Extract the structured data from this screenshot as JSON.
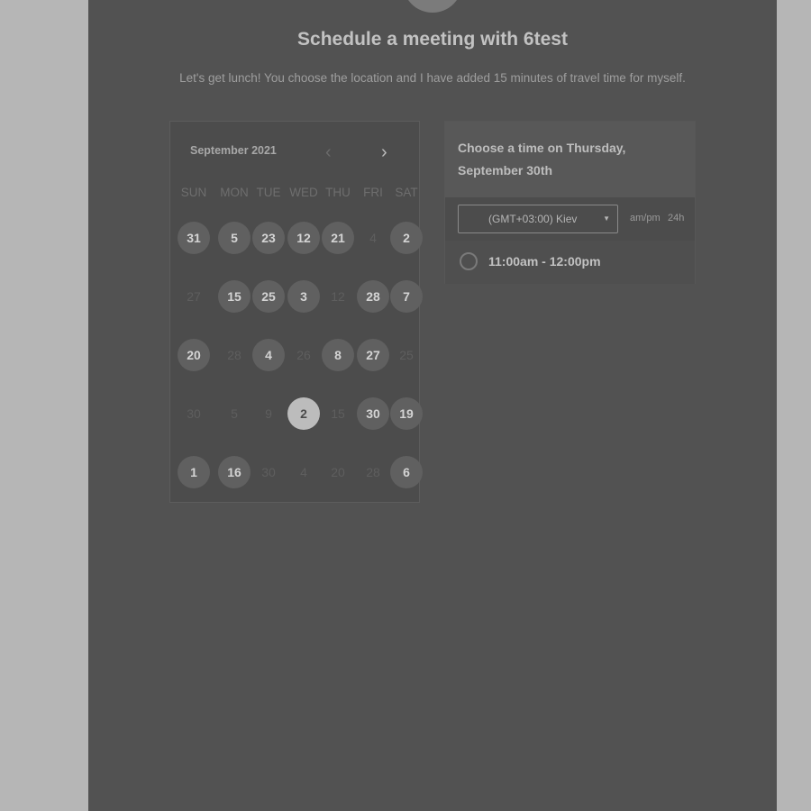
{
  "header": {
    "title": "Schedule a meeting with 6test",
    "description": "Let's get lunch! You choose the location and I have added 15 minutes of travel time for myself."
  },
  "calendar": {
    "month_label": "September 2021",
    "prev_icon": "‹",
    "next_icon": "›",
    "weekdays": [
      "SUN",
      "MON",
      "TUE",
      "WED",
      "THU",
      "FRI",
      "SAT"
    ],
    "weeks": [
      [
        {
          "d": "31",
          "s": "avail"
        },
        {
          "d": "5",
          "s": "avail"
        },
        {
          "d": "23",
          "s": "avail"
        },
        {
          "d": "12",
          "s": "avail"
        },
        {
          "d": "21",
          "s": "avail"
        },
        {
          "d": "4",
          "s": "dim"
        },
        {
          "d": "2",
          "s": "avail"
        }
      ],
      [
        {
          "d": "27",
          "s": "dim"
        },
        {
          "d": "15",
          "s": "avail"
        },
        {
          "d": "25",
          "s": "avail"
        },
        {
          "d": "3",
          "s": "avail"
        },
        {
          "d": "12",
          "s": "dim"
        },
        {
          "d": "28",
          "s": "avail"
        },
        {
          "d": "7",
          "s": "avail"
        }
      ],
      [
        {
          "d": "20",
          "s": "avail"
        },
        {
          "d": "28",
          "s": "dim"
        },
        {
          "d": "4",
          "s": "avail"
        },
        {
          "d": "26",
          "s": "dim"
        },
        {
          "d": "8",
          "s": "avail"
        },
        {
          "d": "27",
          "s": "avail"
        },
        {
          "d": "25",
          "s": "dim"
        }
      ],
      [
        {
          "d": "30",
          "s": "dim"
        },
        {
          "d": "5",
          "s": "dim"
        },
        {
          "d": "9",
          "s": "dim"
        },
        {
          "d": "2",
          "s": "sel"
        },
        {
          "d": "15",
          "s": "dim"
        },
        {
          "d": "30",
          "s": "avail"
        },
        {
          "d": "19",
          "s": "avail"
        }
      ],
      [
        {
          "d": "1",
          "s": "avail"
        },
        {
          "d": "16",
          "s": "avail"
        },
        {
          "d": "30",
          "s": "dim"
        },
        {
          "d": "4",
          "s": "dim"
        },
        {
          "d": "20",
          "s": "dim"
        },
        {
          "d": "28",
          "s": "dim"
        },
        {
          "d": "6",
          "s": "avail"
        }
      ]
    ]
  },
  "times": {
    "heading": "Choose a time on Thursday, September 30th",
    "timezone": "(GMT+03:00) Kiev",
    "caret_icon": "▼",
    "format_ampm": "am/pm",
    "format_24h": "24h",
    "slots": [
      "11:00am - 12:00pm"
    ]
  }
}
